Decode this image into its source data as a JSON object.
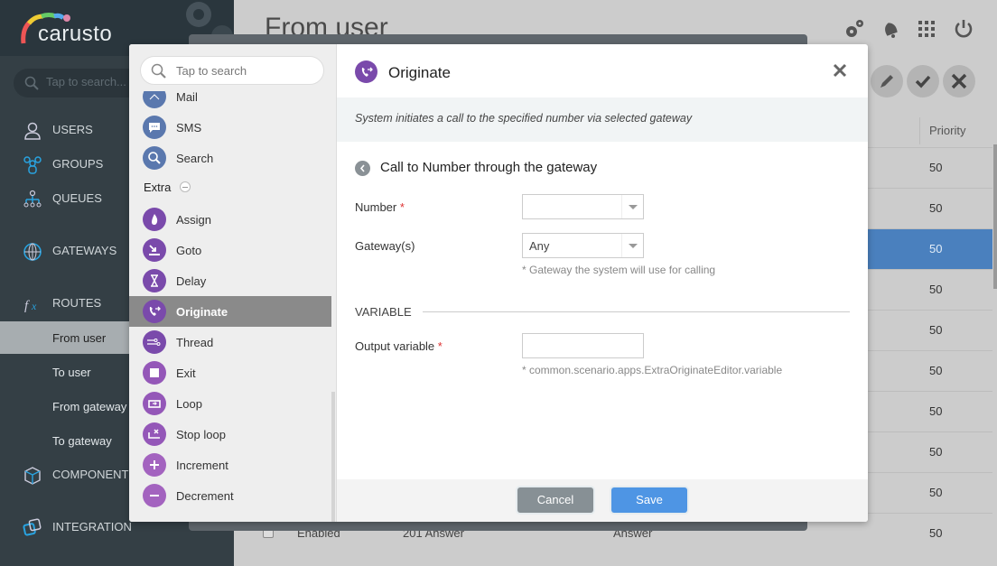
{
  "app": {
    "logo": "carusto"
  },
  "sidebar": {
    "search_placeholder": "Tap to search...",
    "items": [
      {
        "label": "USERS",
        "icon": "user-icon"
      },
      {
        "label": "GROUPS",
        "icon": "groups-icon"
      },
      {
        "label": "QUEUES",
        "icon": "queues-icon"
      },
      {
        "label": "GATEWAYS",
        "icon": "globe-icon"
      },
      {
        "label": "ROUTES",
        "icon": "fx-icon"
      },
      {
        "label": "COMPONENTS",
        "icon": "cube-icon"
      },
      {
        "label": "INTEGRATION",
        "icon": "integration-icon"
      }
    ],
    "route_subitems": [
      "From user",
      "To user",
      "From gateway",
      "To gateway"
    ],
    "active_subitem": "From user"
  },
  "page": {
    "title": "From user",
    "header_icons": [
      "settings-icon",
      "bell-icon",
      "apps-grid-icon",
      "power-icon"
    ],
    "toolbar_buttons": [
      "edit-icon",
      "check-icon",
      "close-icon"
    ],
    "table": {
      "column_priority": "Priority",
      "rows": [
        {
          "priority": "50"
        },
        {
          "priority": "50"
        },
        {
          "priority": "50",
          "selected": true
        },
        {
          "priority": "50"
        },
        {
          "priority": "50"
        },
        {
          "priority": "50"
        },
        {
          "priority": "50"
        },
        {
          "priority": "50"
        },
        {
          "priority": "50"
        },
        {
          "status": "Enabled",
          "name": "201 Answer",
          "type": "Answer",
          "priority": "50"
        }
      ]
    }
  },
  "palette": {
    "search_placeholder": "Tap to search",
    "items_top": [
      {
        "label": "Mail",
        "icon": "mail-icon"
      },
      {
        "label": "SMS",
        "icon": "sms-icon"
      },
      {
        "label": "Search",
        "icon": "search-icon"
      }
    ],
    "group_label": "Extra",
    "items_extra": [
      {
        "label": "Assign",
        "icon": "fire-icon"
      },
      {
        "label": "Goto",
        "icon": "goto-icon"
      },
      {
        "label": "Delay",
        "icon": "hourglass-icon"
      },
      {
        "label": "Originate",
        "icon": "phone-forward-icon",
        "active": true
      },
      {
        "label": "Thread",
        "icon": "thread-icon"
      },
      {
        "label": "Exit",
        "icon": "stop-icon"
      },
      {
        "label": "Loop",
        "icon": "loop-icon"
      },
      {
        "label": "Stop loop",
        "icon": "stop-loop-icon"
      },
      {
        "label": "Increment",
        "icon": "plus-icon"
      },
      {
        "label": "Decrement",
        "icon": "minus-icon"
      }
    ]
  },
  "editor": {
    "title": "Originate",
    "description": "System initiates a call to the specified number via selected gateway",
    "subtitle": "Call to Number through the gateway",
    "fields": {
      "number_label": "Number",
      "number_value": "",
      "gateway_label": "Gateway(s)",
      "gateway_value": "Any",
      "gateway_hint": "* Gateway the system will use for calling",
      "section_label": "VARIABLE",
      "output_label": "Output variable",
      "output_value": "",
      "output_hint": "* common.scenario.apps.ExtraOriginateEditor.variable",
      "required_mark": "*"
    },
    "cancel_label": "Cancel",
    "save_label": "Save"
  },
  "colors": {
    "accent_purple": "#7a4aab",
    "save_blue": "#4e95e4",
    "selected_row": "#4a80be"
  }
}
